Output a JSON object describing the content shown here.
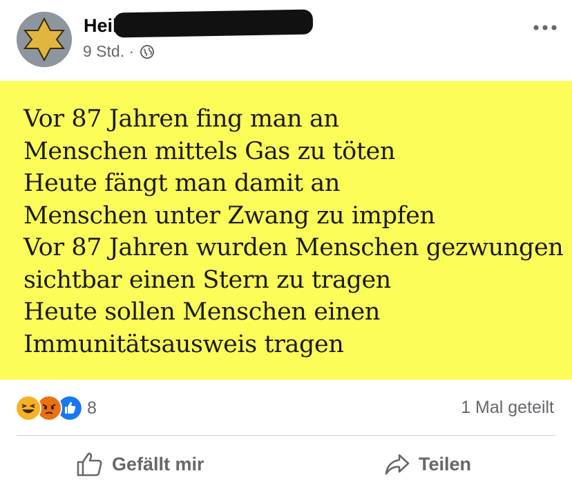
{
  "post": {
    "author": "Heike",
    "time": "9 Std. ·",
    "privacy_icon": "globe-icon",
    "more_icon": "more-options-icon"
  },
  "image_text": {
    "lines": [
      "Vor 87 Jahren fing man an",
      "Menschen mittels Gas zu töten",
      "Heute fängt man damit an",
      "Menschen unter Zwang zu impfen",
      "Vor 87 Jahren wurden Menschen  gezwungen",
      "sichtbar einen Stern zu tragen",
      "Heute sollen Menschen einen",
      "Immunitätsausweis tragen"
    ],
    "background_color": "#fdfd59"
  },
  "engagement": {
    "reactions": [
      "laugh-reaction-icon",
      "angry-reaction-icon",
      "like-reaction-icon"
    ],
    "reaction_count": "8",
    "shares": "1 Mal geteilt"
  },
  "actions": {
    "like_label": "Gefällt mir",
    "share_label": "Teilen"
  },
  "colors": {
    "secondary_text": "#65676b",
    "like_blue": "#1877f2",
    "angry_orange": "#e9710f",
    "laugh_yellow": "#f7b125"
  }
}
